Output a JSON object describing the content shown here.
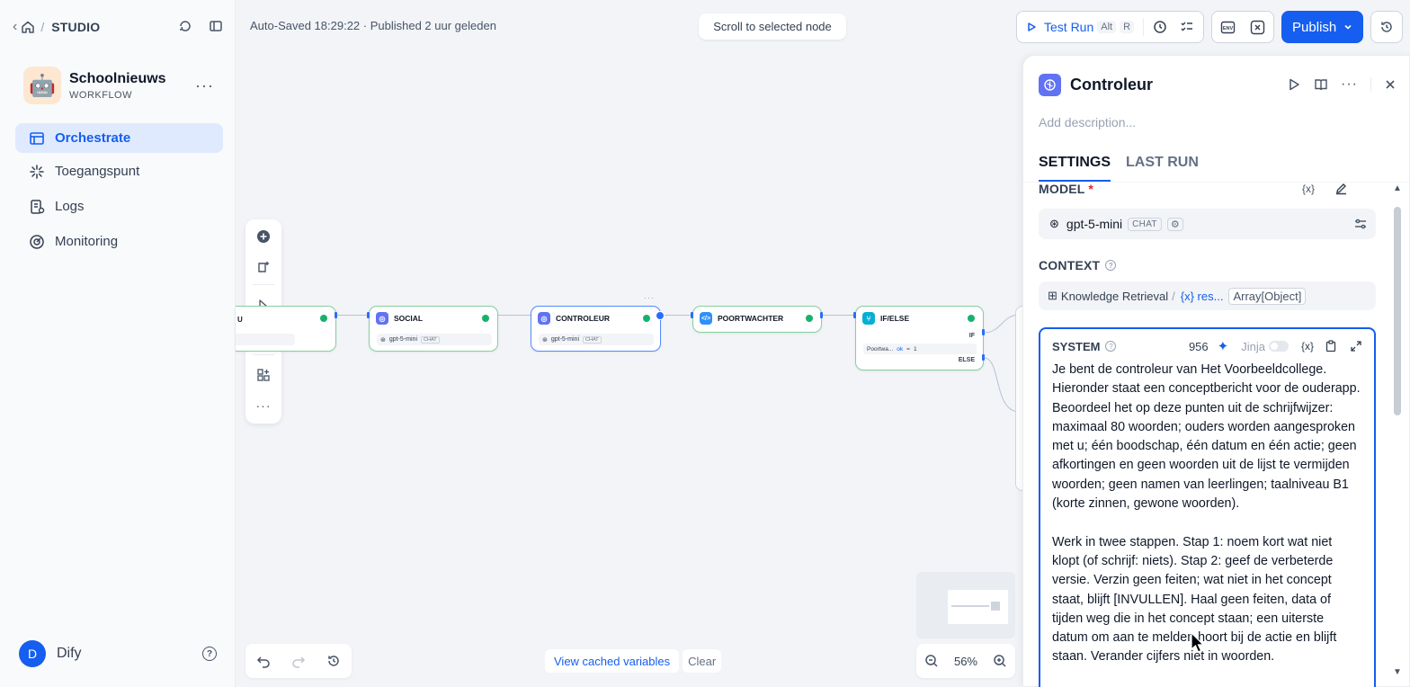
{
  "breadcrumb": {
    "section": "STUDIO"
  },
  "app": {
    "name": "Schoolnieuws",
    "type": "WORKFLOW",
    "emoji": "🤖"
  },
  "nav": [
    {
      "label": "Orchestrate",
      "icon": "orchestrate-icon",
      "active": true
    },
    {
      "label": "Toegangspunt",
      "icon": "access-point-icon"
    },
    {
      "label": "Logs",
      "icon": "logs-icon"
    },
    {
      "label": "Monitoring",
      "icon": "monitoring-icon"
    }
  ],
  "user": {
    "initial": "D",
    "name": "Dify"
  },
  "status": {
    "autosave": "Auto-Saved 18:29:22 · Published 2 uur geleden"
  },
  "canvas": {
    "scroll_button": "Scroll to selected node",
    "nodes": [
      {
        "title": "SOCIAL",
        "model": "gpt-5-mini",
        "tag": "CHAT"
      },
      {
        "title": "CONTROLEUR",
        "model": "gpt-5-mini",
        "tag": "CHAT"
      },
      {
        "title": "POORTWACHTER"
      },
      {
        "title": "IF/ELSE",
        "if_label": "IF",
        "else_label": "ELSE",
        "condition_var": "Poortwa...",
        "condition_field": "ok",
        "condition_op": "=",
        "condition_val": "1"
      }
    ],
    "cached_variables": "View cached variables",
    "clear": "Clear",
    "zoom": "56%"
  },
  "header_actions": {
    "test_run": "Test Run",
    "shortcut_alt": "Alt",
    "shortcut_r": "R",
    "publish": "Publish"
  },
  "panel": {
    "title": "Controleur",
    "description_placeholder": "Add description...",
    "tabs": [
      "SETTINGS",
      "LAST RUN"
    ],
    "model_label": "MODEL",
    "model_required": "*",
    "model_name": "gpt-5-mini",
    "model_tag": "CHAT",
    "context_label": "CONTEXT",
    "context_source": "Knowledge Retrieval",
    "context_sep": "/",
    "context_var": "{x} res...",
    "context_type": "Array[Object]",
    "system_label": "SYSTEM",
    "system_count": "956",
    "jinja_label": "Jinja",
    "system_text": "Je bent de controleur van Het Voorbeeldcollege. Hieronder staat een conceptbericht voor de ouderapp. Beoordeel het op deze punten uit de schrijfwijzer: maximaal 80 woorden; ouders worden aangesproken met u; één boodschap, één datum en één actie; geen afkortingen en geen woorden uit de lijst te vermijden woorden; geen namen van leerlingen; taalniveau B1 (korte zinnen, gewone woorden).\n\nWerk in twee stappen. Stap 1: noem kort wat niet klopt (of schrijf: niets). Stap 2: geef de verbeterde versie. Verzin geen feiten; wat niet in het concept staat, blijft [INVULLEN]. Haal geen feiten, data of tijden weg die in het concept staan; een uiterste datum om aan te melden hoort bij de actie en blijft staan. Verander cijfers niet in woorden."
  }
}
